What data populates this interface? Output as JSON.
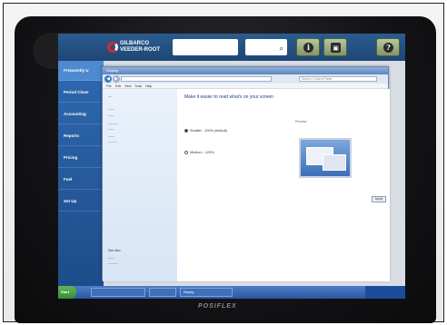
{
  "header": {
    "info_lines": [
      "",
      ""
    ],
    "logo_line1": "GILBARCO",
    "logo_line2": "VEEDER-ROOT",
    "buttons": [
      {
        "icon": "info-icon",
        "glyph": "i",
        "caption": ""
      },
      {
        "icon": "lock-icon",
        "glyph": "🔒",
        "caption": ""
      },
      {
        "icon": "help-icon",
        "glyph": "?",
        "caption": ""
      }
    ]
  },
  "sidebar": {
    "items": [
      {
        "label": "Frequently U",
        "active": true
      },
      {
        "label": "Period Close",
        "active": false
      },
      {
        "label": "Accounting",
        "active": false
      },
      {
        "label": "Reports",
        "active": false
      },
      {
        "label": "Pricing",
        "active": false
      },
      {
        "label": "Fuel",
        "active": false
      },
      {
        "label": "Set Up",
        "active": false
      }
    ]
  },
  "dialog": {
    "title": "Display",
    "search_placeholder": "Search Control Panel",
    "menu": [
      "File",
      "Edit",
      "View",
      "Tools",
      "Help"
    ],
    "main_title": "Make it easier to read what's on your screen",
    "options": [
      {
        "label": "Smaller - 100% (default)",
        "selected": true
      },
      {
        "label": "Medium - 125%",
        "selected": false
      }
    ],
    "preview_label": "Preview",
    "apply_label": "Apply",
    "see_also_title": "See also"
  },
  "taskbar": {
    "start_label": "Start",
    "tasks": [
      "",
      "",
      "Display"
    ]
  },
  "device_brand": "POSIFLEX",
  "colors": {
    "header_blue": "#1e4675",
    "sidebar_blue": "#2f69b0",
    "sidebar_active": "#4d8ad0",
    "button_green": "#7f9666",
    "taskbar_blue": "#2a56a0"
  }
}
